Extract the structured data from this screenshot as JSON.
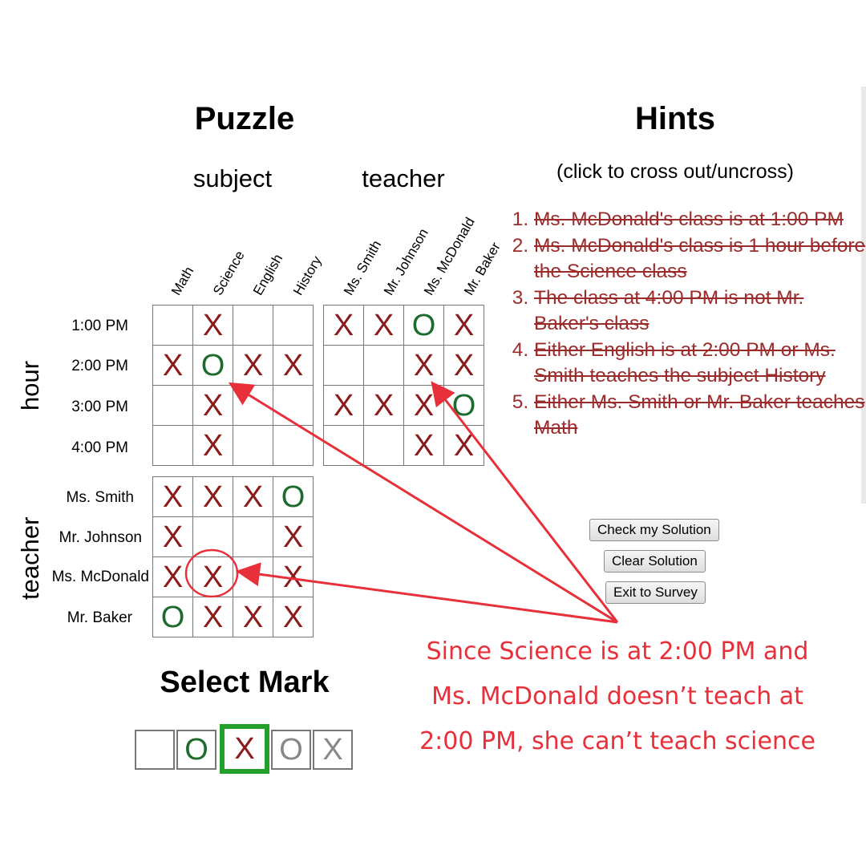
{
  "puzzle": {
    "title": "Puzzle",
    "group_subject": "subject",
    "group_teacher": "teacher",
    "side_hour": "hour",
    "side_teacher": "teacher",
    "subject_cols": [
      "Math",
      "Science",
      "English",
      "History"
    ],
    "teacher_cols": [
      "Ms. Smith",
      "Mr. Johnson",
      "Ms. McDonald",
      "Mr. Baker"
    ],
    "hour_rows": [
      "1:00 PM",
      "2:00 PM",
      "3:00 PM",
      "4:00 PM"
    ],
    "teacher_rows": [
      "Ms. Smith",
      "Mr. Johnson",
      "Ms. McDonald",
      "Mr. Baker"
    ],
    "grid_hour_subject": [
      [
        "",
        "X",
        "",
        ""
      ],
      [
        "X",
        "O",
        "X",
        "X"
      ],
      [
        "",
        "X",
        "",
        ""
      ],
      [
        "",
        "X",
        "",
        ""
      ]
    ],
    "grid_hour_teacher": [
      [
        "X",
        "X",
        "O",
        "X"
      ],
      [
        "",
        "",
        "X",
        "X"
      ],
      [
        "X",
        "X",
        "X",
        "O"
      ],
      [
        "",
        "",
        "X",
        "X"
      ]
    ],
    "grid_teacher_subject": [
      [
        "X",
        "X",
        "X",
        "O"
      ],
      [
        "X",
        "",
        "",
        "X"
      ],
      [
        "X",
        "X",
        "",
        "X"
      ],
      [
        "O",
        "X",
        "X",
        "X"
      ]
    ]
  },
  "hints": {
    "title": "Hints",
    "subtitle": "(click to cross out/uncross)",
    "items": [
      "Ms. McDonald's class is at 1:00 PM",
      "Ms. McDonald's class is 1 hour before the Science class",
      "The class at 4:00 PM is not Mr. Baker's class",
      "Either English is at 2:00 PM or Ms. Smith teaches the subject History",
      "Either Ms. Smith or Mr. Baker teaches Math"
    ],
    "crossed_out": [
      true,
      true,
      true,
      true,
      true
    ]
  },
  "buttons": {
    "check": "Check my Solution",
    "clear": "Clear Solution",
    "exit": "Exit to Survey"
  },
  "select_mark": {
    "title": "Select Mark",
    "options": [
      "",
      "O",
      "X",
      "O",
      "X"
    ],
    "option_colors": [
      "#000000",
      "#1e6b2e",
      "#8b1a1a",
      "#888888",
      "#888888"
    ],
    "selected_index": 2,
    "selected_color": "#22a02a"
  },
  "annotation": {
    "text_lines": [
      "Since Science is at 2:00 PM and",
      "Ms. McDonald doesn’t teach at",
      "2:00 PM, she can’t teach science"
    ],
    "color": "#e8303a"
  },
  "colors": {
    "x_mark": "#8b1a1a",
    "o_mark": "#1e6b2e",
    "hint_text": "#9b2b2b"
  }
}
